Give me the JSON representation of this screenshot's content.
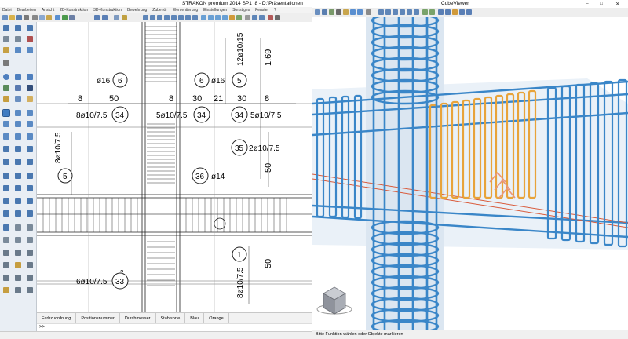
{
  "left_window": {
    "title": "STRAKON premium 2014 SP1 .8 - D:\\Präsentationen",
    "menu": [
      "Datei",
      "Bearbeiten",
      "Ansicht",
      "2D-Konstruktion",
      "3D-Konstruktion",
      "Bewehrung",
      "Zubehör",
      "Elementierung",
      "Einstellungen",
      "Sonstiges",
      "Fenster",
      "?"
    ],
    "status_bar": [
      "Farbzuordnung",
      "Positionsnummer",
      "Durchmesser",
      "Stahlsorte",
      "Blau",
      "Orange"
    ],
    "command_prompt": ">>"
  },
  "drawing": {
    "position_labels": [
      {
        "num": "6",
        "text": "ø16"
      },
      {
        "num": "6",
        "text": "ø16"
      },
      {
        "num": "5",
        "text": "12ø10/15"
      },
      {
        "num": "34",
        "text": "8ø10/7.5"
      },
      {
        "num": "34",
        "text": "5ø10/7.5"
      },
      {
        "num": "34",
        "text": "5ø10/7.5"
      },
      {
        "num": "35",
        "text": "2ø10/7.5"
      },
      {
        "num": "5",
        "text": "8ø10/7.5"
      },
      {
        "num": "36",
        "text": "ø14"
      },
      {
        "num": "1",
        "text": "8ø10/7.5"
      },
      {
        "num": "33",
        "text": "6ø10/7.5"
      }
    ],
    "dimensions": [
      "8",
      "50",
      "8",
      "30",
      "21",
      "30",
      "8",
      "1.69",
      "50",
      "50",
      "2"
    ]
  },
  "right_window": {
    "title": "CubeViewer",
    "status": "Bitte Funktion wählen oder Objekte markieren"
  },
  "colors": {
    "rebar_blue": "#3a86c8",
    "rebar_orange": "#e8a33a",
    "accent_red": "#d95a3a"
  }
}
